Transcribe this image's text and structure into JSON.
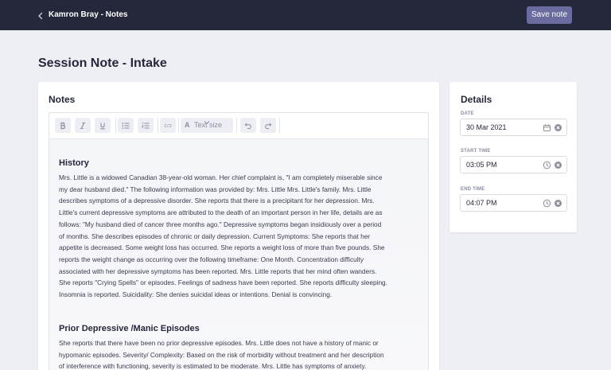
{
  "header": {
    "breadcrumb": "Kamron Bray - Notes",
    "save_label": "Save note"
  },
  "page": {
    "title": "Session Note - Intake"
  },
  "notes": {
    "heading": "Notes",
    "toolbar": {
      "text_size_label": "Text size"
    },
    "sections": [
      {
        "title": "History",
        "lines": [
          "Mrs. Little is a widowed Canadian 38-year-old woman. Her chief complaint is, \"I am completely miserable since",
          "my dear husband died.\" The following information was provided by: Mrs. Little Mrs. Little's family. Mrs. Little",
          "describes symptoms of a depressive disorder. She reports that there is a precipitant for her depression. Mrs.",
          "Little's current depressive symptoms are attributed to the death of an important person in her life, details are as",
          "follows: \"My husband died of cancer three months ago.\" Depressive symptoms began insidiously over a period",
          "of months. She describes episodes of chronic or daily depression. Current Symptoms: She reports that her",
          "appetite is decreased. Some weight loss has occurred. She reports a weight loss of more than five pounds. She",
          "reports the weight change as occurring over the following timeframe: One Month. Concentration difficulty",
          "associated with her depressive symptoms has been reported. Mrs. Little reports that her mind often wanders.",
          "She reports \"Crying Spells\" or episodes. Feelings of sadness have been reported. She reports difficulty sleeping.",
          "Insomnia is reported. Suicidality: She denies suicidal ideas or intentions. Denial is convincing."
        ]
      },
      {
        "title": "Prior Depressive /Manic Episodes",
        "lines": [
          "She reports that there have been no prior depressive episodes. Mrs. Little does not have a history of manic or",
          "hypomanic episodes. Severity/ Complexity: Based on the risk of morbidity without treatment and her description",
          "of interference with functioning, severity is estimated to be moderate. Mrs. Little has symptoms of anxiety."
        ]
      }
    ]
  },
  "details": {
    "heading": "Details",
    "date": {
      "label": "DATE",
      "value": "30 Mar 2021"
    },
    "start_time": {
      "label": "START TIME",
      "value": "03:05 PM"
    },
    "end_time": {
      "label": "END TIME",
      "value": "04:07 PM"
    }
  },
  "colors": {
    "topbar": "#25283a",
    "accent": "#6a6b9e",
    "background": "#eeeff4"
  },
  "icons": {
    "back": "chevron-left-icon",
    "bold": "bold-icon",
    "italic": "italic-icon",
    "underline": "underline-icon",
    "bullet_list": "bullet-list-icon",
    "numbered_list": "numbered-list-icon",
    "link": "link-icon",
    "undo": "undo-icon",
    "redo": "redo-icon",
    "calendar": "calendar-icon",
    "clock": "clock-icon",
    "clear": "clear-icon"
  }
}
